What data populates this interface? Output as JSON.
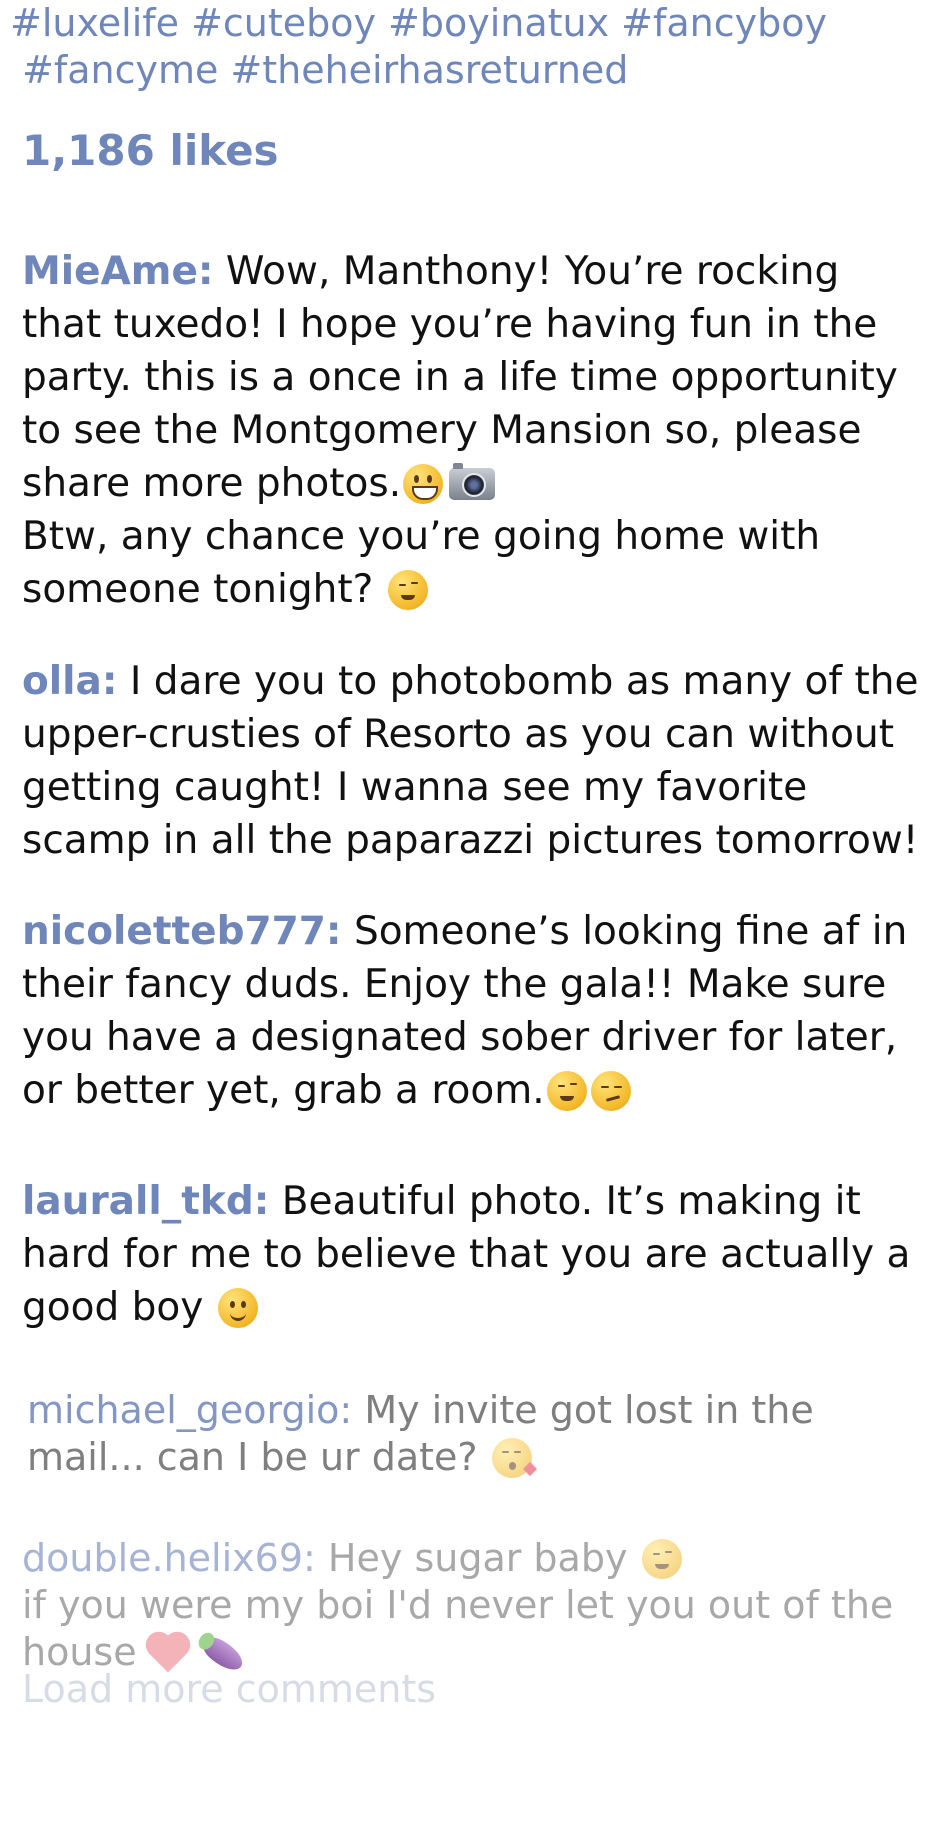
{
  "caption": {
    "hashtags_line1": [
      "#luxelife",
      "#cuteboy",
      "#boyinatux",
      "#fancyboy"
    ],
    "hashtags_line2": [
      "#fancyme",
      "#theheirhasreturned"
    ]
  },
  "likes": {
    "text": "1,186 likes"
  },
  "comments": [
    {
      "username": "MieAme:",
      "text_part1": "Wow, Manthony! You’re rocking that tuxedo! I hope you’re having fun in the party. this is a once in a life time opportunity to see the Montgomery Mansion so, please share more photos.",
      "text_part2": "Btw, any chance you’re going home with someone tonight?"
    },
    {
      "username": "olla:",
      "text": "I dare you to photobomb as many of the upper-crusties of Resorto as you can without getting caught! I wanna see my favorite scamp in all the paparazzi pictures tomorrow!"
    },
    {
      "username": "nicoletteb777:",
      "text": "Someone’s looking fine af in their fancy duds. Enjoy the gala!! Make sure you have a designated sober driver for later, or better yet, grab a room."
    },
    {
      "username": "laurall_tkd:",
      "text": "Beautiful photo. It’s making it hard for me to believe that you are actually a good boy"
    },
    {
      "username": "michael_georgio:",
      "text": "My invite got lost in the mail... can I be ur date?"
    },
    {
      "username": "double.helix69:",
      "text_part1": "Hey sugar baby",
      "text_part2": "if you were my boi I'd never let you out of the house"
    }
  ],
  "load_more": {
    "label": "Load more comments"
  },
  "icons": {
    "grinning_face": "grinning-face-icon",
    "camera": "camera-icon",
    "winking_face": "winking-face-icon",
    "smirking_face": "smirking-face-icon",
    "slightly_smiling_face": "slightly-smiling-face-icon",
    "kissing_face": "face-blowing-kiss-icon",
    "heart": "heart-icon",
    "eggplant": "eggplant-icon"
  },
  "colors": {
    "username": "#6f86bb",
    "body_text": "#111111",
    "faded_text": "#7f7f7f",
    "load_more": "#d6dbe6"
  }
}
